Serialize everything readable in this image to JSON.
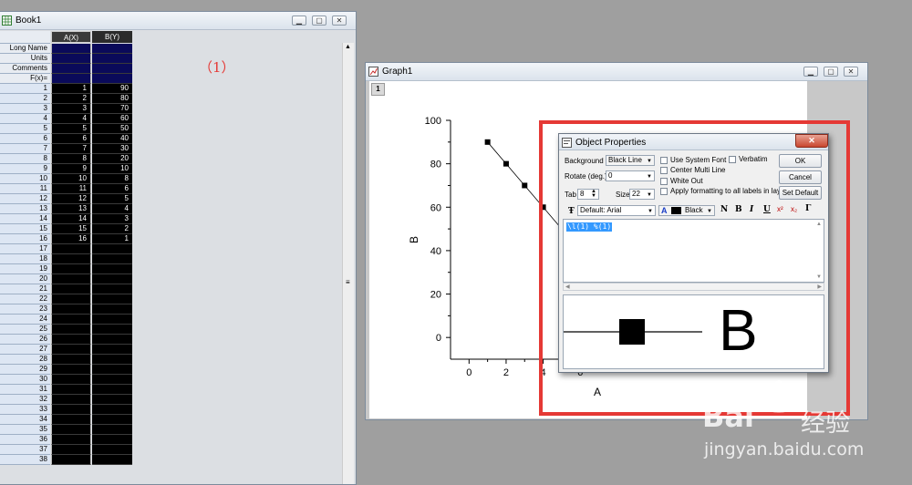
{
  "book": {
    "title": "Book1",
    "columns": [
      "A(X)",
      "B(Y)"
    ],
    "row_labels": [
      "Long Name",
      "Units",
      "Comments",
      "F(x)="
    ],
    "row_count": 38,
    "col_a": [
      1,
      2,
      3,
      4,
      5,
      6,
      7,
      8,
      9,
      10,
      11,
      12,
      13,
      14,
      15,
      16
    ],
    "col_b": [
      90,
      80,
      70,
      60,
      50,
      40,
      30,
      20,
      10,
      8,
      6,
      5,
      4,
      3,
      2,
      1
    ],
    "annotation": "（1）"
  },
  "graph": {
    "title": "Graph1",
    "layer_tag": "1",
    "chart_data": {
      "type": "line",
      "xlabel": "A",
      "ylabel": "B",
      "yticks": [
        "0",
        "20",
        "40",
        "60",
        "80",
        "100"
      ],
      "xticks": [
        "0",
        "2",
        "4",
        "6"
      ],
      "ylim": [
        -10,
        100
      ],
      "xlim": [
        -1,
        18
      ],
      "x": [
        1,
        2,
        3,
        4,
        5,
        6,
        7,
        8,
        9,
        10,
        11,
        12,
        13,
        14,
        15,
        16
      ],
      "y": [
        90,
        80,
        70,
        60,
        50,
        40,
        30,
        20,
        10,
        8,
        6,
        5,
        4,
        3,
        2,
        1
      ]
    }
  },
  "dialog": {
    "title": "Object Properties",
    "background_label": "Background",
    "background_value": "Black Line",
    "rotate_label": "Rotate (deg.)",
    "rotate_value": "0",
    "tab_label": "Tab",
    "tab_value": "8",
    "size_label": "Size",
    "size_value": "22",
    "use_system_font": "Use System Font",
    "verbatim": "Verbatim",
    "center_multi_line": "Center Multi Line",
    "white_out": "White Out",
    "apply_formatting": "Apply formatting to all labels in layer",
    "ok": "OK",
    "cancel": "Cancel",
    "set_default": "Set Default",
    "font_value": "Default: Arial",
    "color_value": "Black",
    "fmt_bold": "B",
    "fmt_italic": "I",
    "fmt_underline": "U",
    "fmt_normal": "N",
    "fmt_sup": "x²",
    "fmt_sub": "x₂",
    "fmt_greek": "Γ",
    "text_content": "\\l(1) %(1)",
    "preview_text": "B"
  },
  "watermark": {
    "brand": "Bai",
    "brand2": "经验",
    "url": "jingyan.baidu.com"
  },
  "colors": {
    "highlight_red": "#e53935",
    "annotation_red": "#e53935",
    "selection_blue": "#3399ff"
  }
}
